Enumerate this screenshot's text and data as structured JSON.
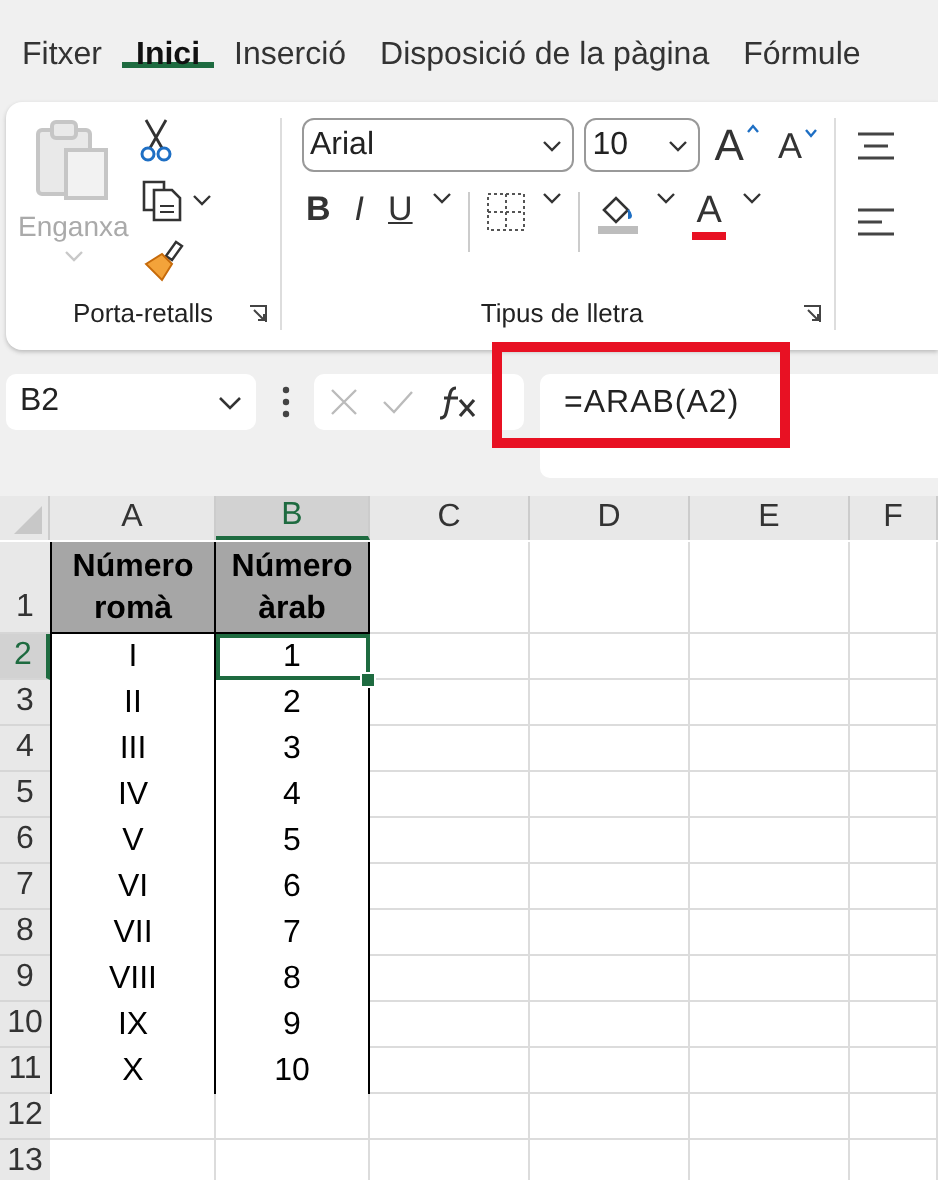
{
  "tabs": [
    {
      "label": "Fitxer",
      "selected": false
    },
    {
      "label": "Inici",
      "selected": true
    },
    {
      "label": "Inserció",
      "selected": false
    },
    {
      "label": "Disposició de la pàgina",
      "selected": false
    },
    {
      "label": "Fórmule",
      "selected": false
    }
  ],
  "clipboard": {
    "paste_label": "Enganxa",
    "paste_disabled": true,
    "group_label": "Porta-retalls"
  },
  "font": {
    "family": "Arial",
    "size": "10",
    "grow": "A",
    "shrink": "A",
    "bold": "B",
    "italic": "I",
    "underline": "U",
    "color_letter": "A",
    "group_label": "Tipus de lletra"
  },
  "formula_bar": {
    "name_box": "B2",
    "formula": "=ARAB(A2)",
    "highlighted": true
  },
  "columns": [
    {
      "label": "A",
      "selected": false
    },
    {
      "label": "B",
      "selected": true
    },
    {
      "label": "C",
      "selected": false
    },
    {
      "label": "D",
      "selected": false
    },
    {
      "label": "E",
      "selected": false
    },
    {
      "label": "F",
      "selected": false
    }
  ],
  "rows": [
    {
      "label": "1",
      "selected": false,
      "kind": "header",
      "cells": [
        "Número romà",
        "Número àrab"
      ]
    },
    {
      "label": "2",
      "selected": true,
      "kind": "data",
      "cells": [
        "I",
        "1"
      ]
    },
    {
      "label": "3",
      "selected": false,
      "kind": "data",
      "cells": [
        "II",
        "2"
      ]
    },
    {
      "label": "4",
      "selected": false,
      "kind": "data",
      "cells": [
        "III",
        "3"
      ]
    },
    {
      "label": "5",
      "selected": false,
      "kind": "data",
      "cells": [
        "IV",
        "4"
      ]
    },
    {
      "label": "6",
      "selected": false,
      "kind": "data",
      "cells": [
        "V",
        "5"
      ]
    },
    {
      "label": "7",
      "selected": false,
      "kind": "data",
      "cells": [
        "VI",
        "6"
      ]
    },
    {
      "label": "8",
      "selected": false,
      "kind": "data",
      "cells": [
        "VII",
        "7"
      ]
    },
    {
      "label": "9",
      "selected": false,
      "kind": "data",
      "cells": [
        "VIII",
        "8"
      ]
    },
    {
      "label": "10",
      "selected": false,
      "kind": "data",
      "cells": [
        "IX",
        "9"
      ]
    },
    {
      "label": "11",
      "selected": false,
      "kind": "data",
      "cells": [
        "X",
        "10"
      ]
    },
    {
      "label": "12",
      "selected": false,
      "kind": "empty",
      "cells": []
    },
    {
      "label": "13",
      "selected": false,
      "kind": "empty",
      "cells": []
    }
  ]
}
